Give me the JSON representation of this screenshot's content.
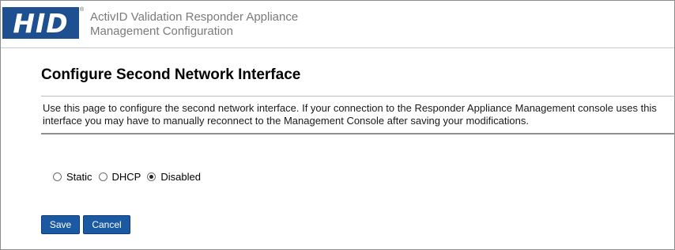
{
  "header": {
    "logo_text": "HID",
    "logo_registered": "®",
    "app_title_line1": "ActivID Validation Responder Appliance",
    "app_title_line2": "Management Configuration",
    "logo_color": "#1d4f91"
  },
  "page": {
    "title": "Configure Second Network Interface",
    "description_line1": "Use this page to configure the second network interface. If your connection to the Responder Appliance Management console uses this",
    "description_line2": "interface you may have to manually reconnect to the Management Console after saving your modifications."
  },
  "network_mode": {
    "options": [
      {
        "label": "Static",
        "checked": false
      },
      {
        "label": "DHCP",
        "checked": false
      },
      {
        "label": "Disabled",
        "checked": true
      }
    ],
    "selected": "Disabled"
  },
  "buttons": {
    "save_label": "Save",
    "cancel_label": "Cancel",
    "button_color": "#1b5aa3"
  }
}
